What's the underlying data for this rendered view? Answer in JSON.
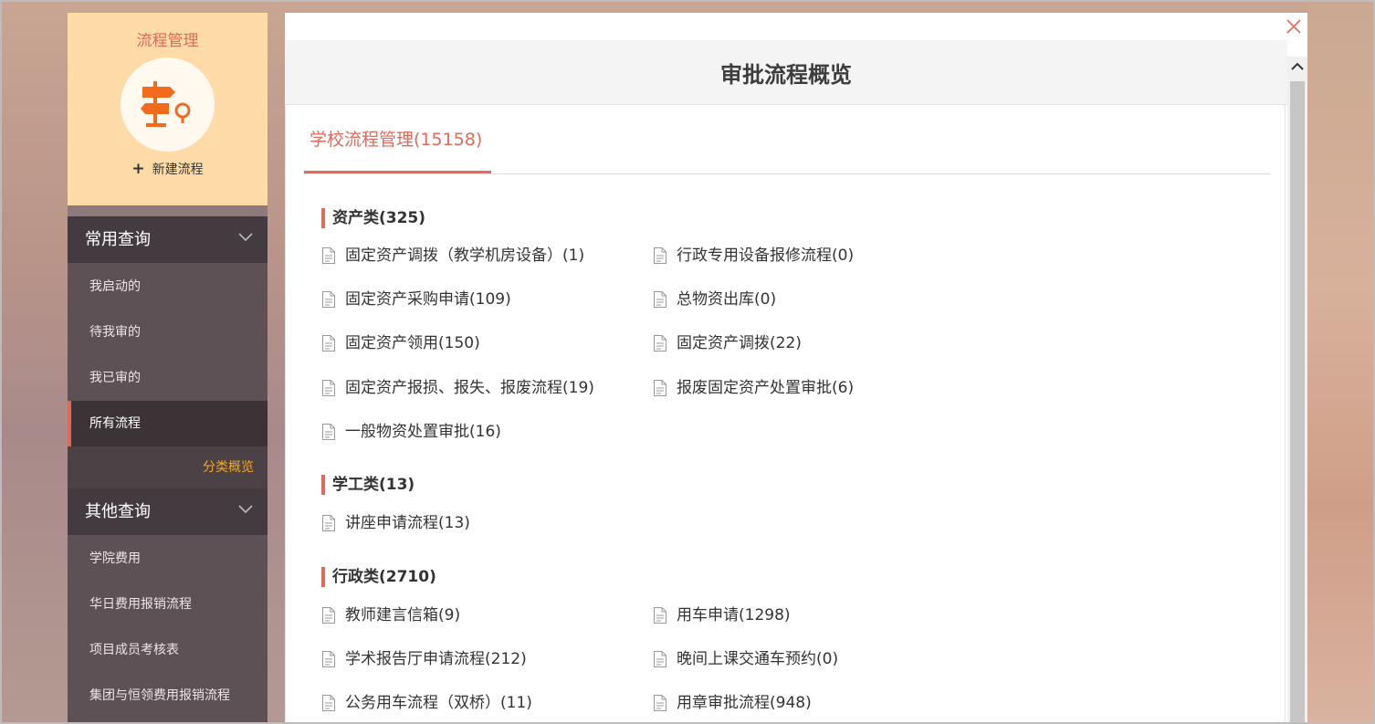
{
  "sidebar": {
    "title": "流程管理",
    "new_flow": "新建流程",
    "groups": [
      {
        "label": "常用查询",
        "items": [
          "我启动的",
          "待我审的",
          "我已审的",
          "所有流程"
        ],
        "active_item": "所有流程",
        "sub_link": "分类概览"
      },
      {
        "label": "其他查询",
        "items": [
          "学院费用",
          "华日费用报销流程",
          "项目成员考核表",
          "集团与恒领费用报销流程"
        ]
      }
    ]
  },
  "modal": {
    "title": "审批流程概览",
    "tab": "学校流程管理(15158)",
    "sections": [
      {
        "title": "资产类(325)",
        "items": [
          "固定资产调拨（教学机房设备）(1)",
          "行政专用设备报修流程(0)",
          "固定资产采购申请(109)",
          "总物资出库(0)",
          "固定资产领用(150)",
          "固定资产调拨(22)",
          "固定资产报损、报失、报废流程(19)",
          "报废固定资产处置审批(6)",
          "一般物资处置审批(16)"
        ]
      },
      {
        "title": "学工类(13)",
        "items": [
          "讲座申请流程(13)"
        ]
      },
      {
        "title": "行政类(2710)",
        "items": [
          "教师建言信箱(9)",
          "用车申请(1298)",
          "学术报告厅申请流程(212)",
          "晚间上课交通车预约(0)",
          "公务用车流程（双桥）(11)",
          "用章审批流程(948)"
        ]
      }
    ]
  },
  "colors": {
    "accent": "#e16a5c",
    "sidebar_bg": "#5d5156",
    "sidebar_header_bg": "#fedba7",
    "sub_link": "#f5a623"
  }
}
